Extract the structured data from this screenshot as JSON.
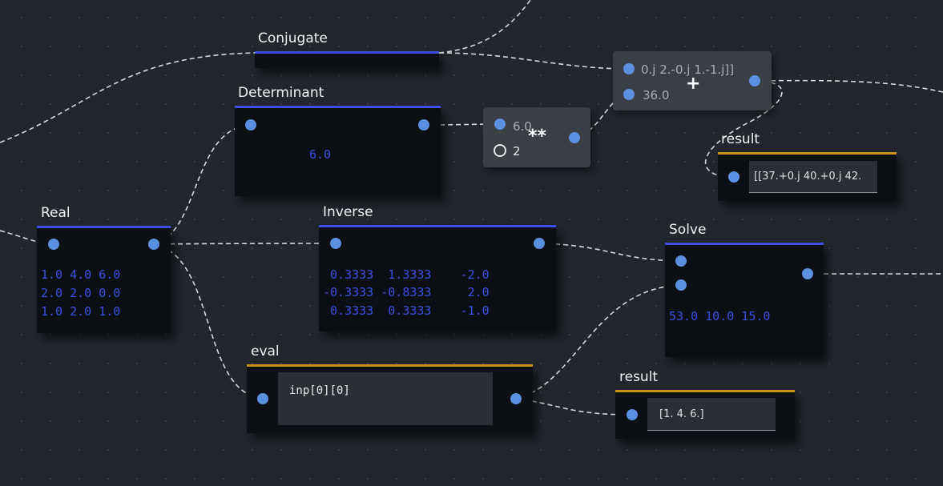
{
  "colors": {
    "background": "#22262d",
    "node_header_blue": "#3d4ee0",
    "node_header_gold": "#c9931a",
    "port": "#5b8fe0",
    "matrix_text": "#3b4fe0"
  },
  "nodes": {
    "conjugate": {
      "title": "Conjugate"
    },
    "determinant": {
      "title": "Determinant",
      "value": "6.0"
    },
    "power": {
      "operator": "**",
      "input_a": "6.0",
      "input_b": "2"
    },
    "add": {
      "operator": "+",
      "input_a": "0.j 2.-0.j 1.-1.j]]",
      "input_b": "36.0"
    },
    "result_top": {
      "title": "result",
      "value": "[[37.+0.j 40.+0.j 42."
    },
    "real": {
      "title": "Real",
      "rows": [
        "1.0 4.0 6.0",
        "2.0 2.0 0.0",
        "1.0 2.0 1.0"
      ]
    },
    "inverse": {
      "title": "Inverse",
      "rows": [
        " 0.3333  1.3333    -2.0",
        "-0.3333 -0.8333     2.0",
        " 0.3333  0.3333    -1.0"
      ]
    },
    "solve": {
      "title": "Solve",
      "value": "53.0 10.0 15.0"
    },
    "eval": {
      "title": "eval",
      "code": "inp[0][0]"
    },
    "result_bottom": {
      "title": "result",
      "value": "[1. 4. 6.]"
    }
  }
}
